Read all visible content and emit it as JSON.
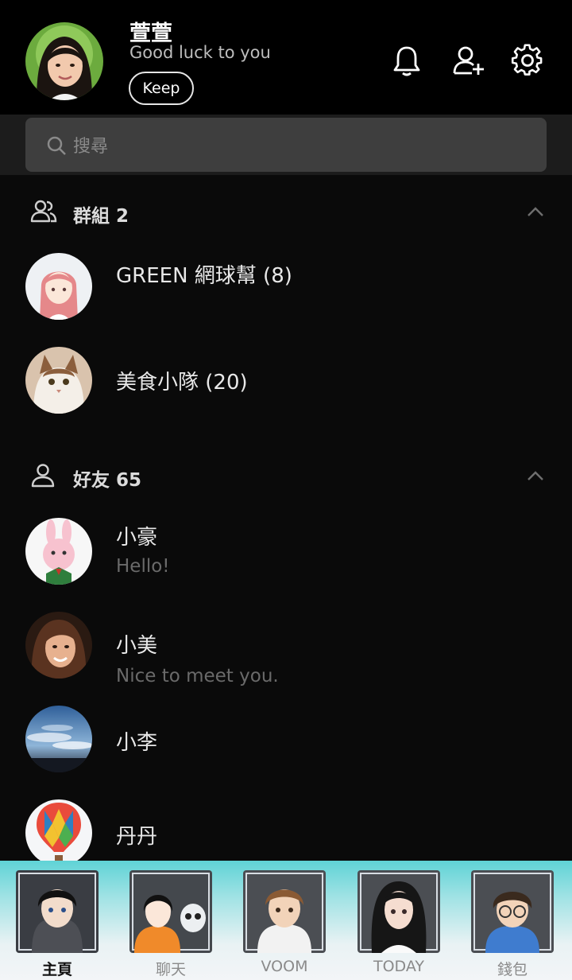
{
  "profile": {
    "name": "萱萱",
    "status": "Good luck to you",
    "keep_label": "Keep"
  },
  "header_icons": [
    "bell-icon",
    "add-friend-icon",
    "gear-icon"
  ],
  "search": {
    "placeholder": "搜尋"
  },
  "groups": {
    "title": "群組 2",
    "items": [
      {
        "name": "GREEN 網球幫 (8)",
        "avatar": "anime-girl-pink-hair"
      },
      {
        "name": "美食小隊 (20)",
        "avatar": "cat"
      }
    ]
  },
  "friends": {
    "title": "好友 65",
    "items": [
      {
        "name": "小豪",
        "message": "Hello!",
        "avatar": "pink-rabbit"
      },
      {
        "name": "小美",
        "message": "Nice to meet you.",
        "avatar": "woman-portrait"
      },
      {
        "name": "小李",
        "message": "",
        "avatar": "sky-clouds"
      },
      {
        "name": "丹丹",
        "message": "",
        "avatar": "hot-air-balloon"
      }
    ]
  },
  "bottom_nav": [
    {
      "label": "主頁",
      "active": true
    },
    {
      "label": "聊天",
      "active": false
    },
    {
      "label": "VOOM",
      "active": false
    },
    {
      "label": "TODAY",
      "active": false
    },
    {
      "label": "錢包",
      "active": false
    }
  ],
  "colors": {
    "background": "#0a0a0a",
    "header": "#000000",
    "search_box": "#3e3e3e",
    "nav_gradient_top": "#5fd3d6"
  }
}
